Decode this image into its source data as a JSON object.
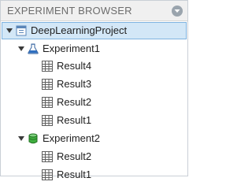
{
  "panel": {
    "title": "EXPERIMENT BROWSER"
  },
  "tree": {
    "project": {
      "label": "DeepLearningProject"
    },
    "experiments": [
      {
        "label": "Experiment1",
        "results": [
          "Result4",
          "Result3",
          "Result2",
          "Result1"
        ]
      },
      {
        "label": "Experiment2",
        "results": [
          "Result2",
          "Result1"
        ]
      }
    ]
  },
  "colors": {
    "selection_bg": "#d3e7f7",
    "selection_border": "#7fb3e0",
    "header_bg": "#f0f0f0"
  },
  "icons": {
    "project": "project-icon",
    "experiment1": "flask-icon",
    "experiment2": "cylinder-icon",
    "result": "table-grid-icon",
    "expanded": "caret-down-icon",
    "panel_menu": "chevron-down-circle-icon"
  }
}
